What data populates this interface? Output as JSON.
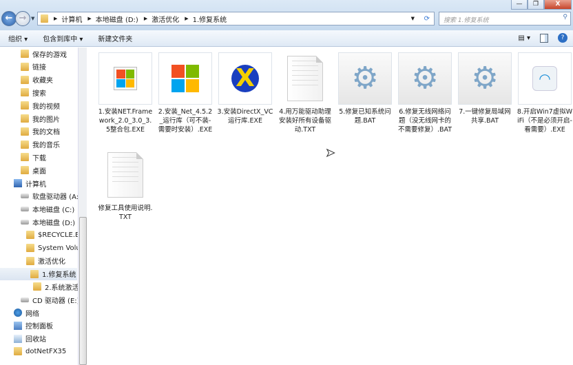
{
  "window": {
    "minimize": "—",
    "maximize": "❐",
    "close": "X"
  },
  "address": {
    "crumbs": [
      "计算机",
      "本地磁盘 (D:)",
      "激活优化",
      "1.修复系统"
    ],
    "search_placeholder": "搜索 1.修复系统"
  },
  "toolbar": {
    "organize": "组织 ▾",
    "include_library": "包含到库中 ▾",
    "new_folder": "新建文件夹",
    "view": "▤ ▾",
    "help": "?"
  },
  "sidebar": {
    "items": [
      {
        "label": "保存的游戏",
        "icon": "folder"
      },
      {
        "label": "链接",
        "icon": "folder"
      },
      {
        "label": "收藏夹",
        "icon": "folder"
      },
      {
        "label": "搜索",
        "icon": "folder"
      },
      {
        "label": "我的视频",
        "icon": "folder"
      },
      {
        "label": "我的图片",
        "icon": "folder"
      },
      {
        "label": "我的文档",
        "icon": "folder"
      },
      {
        "label": "我的音乐",
        "icon": "folder"
      },
      {
        "label": "下载",
        "icon": "folder"
      },
      {
        "label": "桌面",
        "icon": "folder"
      },
      {
        "label": "计算机",
        "icon": "computer"
      },
      {
        "label": "软盘驱动器 (A:",
        "icon": "drive"
      },
      {
        "label": "本地磁盘 (C:)",
        "icon": "drive"
      },
      {
        "label": "本地磁盘 (D:)",
        "icon": "drive"
      },
      {
        "label": "$RECYCLE.B",
        "icon": "folder"
      },
      {
        "label": "System Volu",
        "icon": "folder"
      },
      {
        "label": "激活优化",
        "icon": "folder"
      },
      {
        "label": "1.修复系统",
        "icon": "folder"
      },
      {
        "label": "2.系统激活",
        "icon": "folder"
      },
      {
        "label": "CD 驱动器 (E:)",
        "icon": "drive"
      },
      {
        "label": "网络",
        "icon": "network"
      },
      {
        "label": "控制面板",
        "icon": "control-panel"
      },
      {
        "label": "回收站",
        "icon": "recycle-bin"
      },
      {
        "label": "dotNetFX35",
        "icon": "folder"
      }
    ]
  },
  "files": [
    {
      "name": "1.安装NET.Framework_2.0_3.0_3.5整合包.EXE",
      "type": "exe-windows"
    },
    {
      "name": "2.安装_Net_4.5.2_运行库（可不装-需要时安装）.EXE",
      "type": "exe-ms"
    },
    {
      "name": "3.安装DirectX_VC运行库.EXE",
      "type": "exe-directx"
    },
    {
      "name": "4.用万能驱动助理安装好所有设备驱动.TXT",
      "type": "txt"
    },
    {
      "name": "5.修复已知系统问题.BAT",
      "type": "bat"
    },
    {
      "name": "6.修复无线网络问题（没无线网卡的不需要修复）.BAT",
      "type": "bat"
    },
    {
      "name": "7.一键修复局域网共享.BAT",
      "type": "bat"
    },
    {
      "name": "8.开启Win7虚拟WiFi（不是必须开启-看需要）.EXE",
      "type": "exe-wifi"
    },
    {
      "name": "修复工具使用说明.TXT",
      "type": "txt"
    }
  ]
}
